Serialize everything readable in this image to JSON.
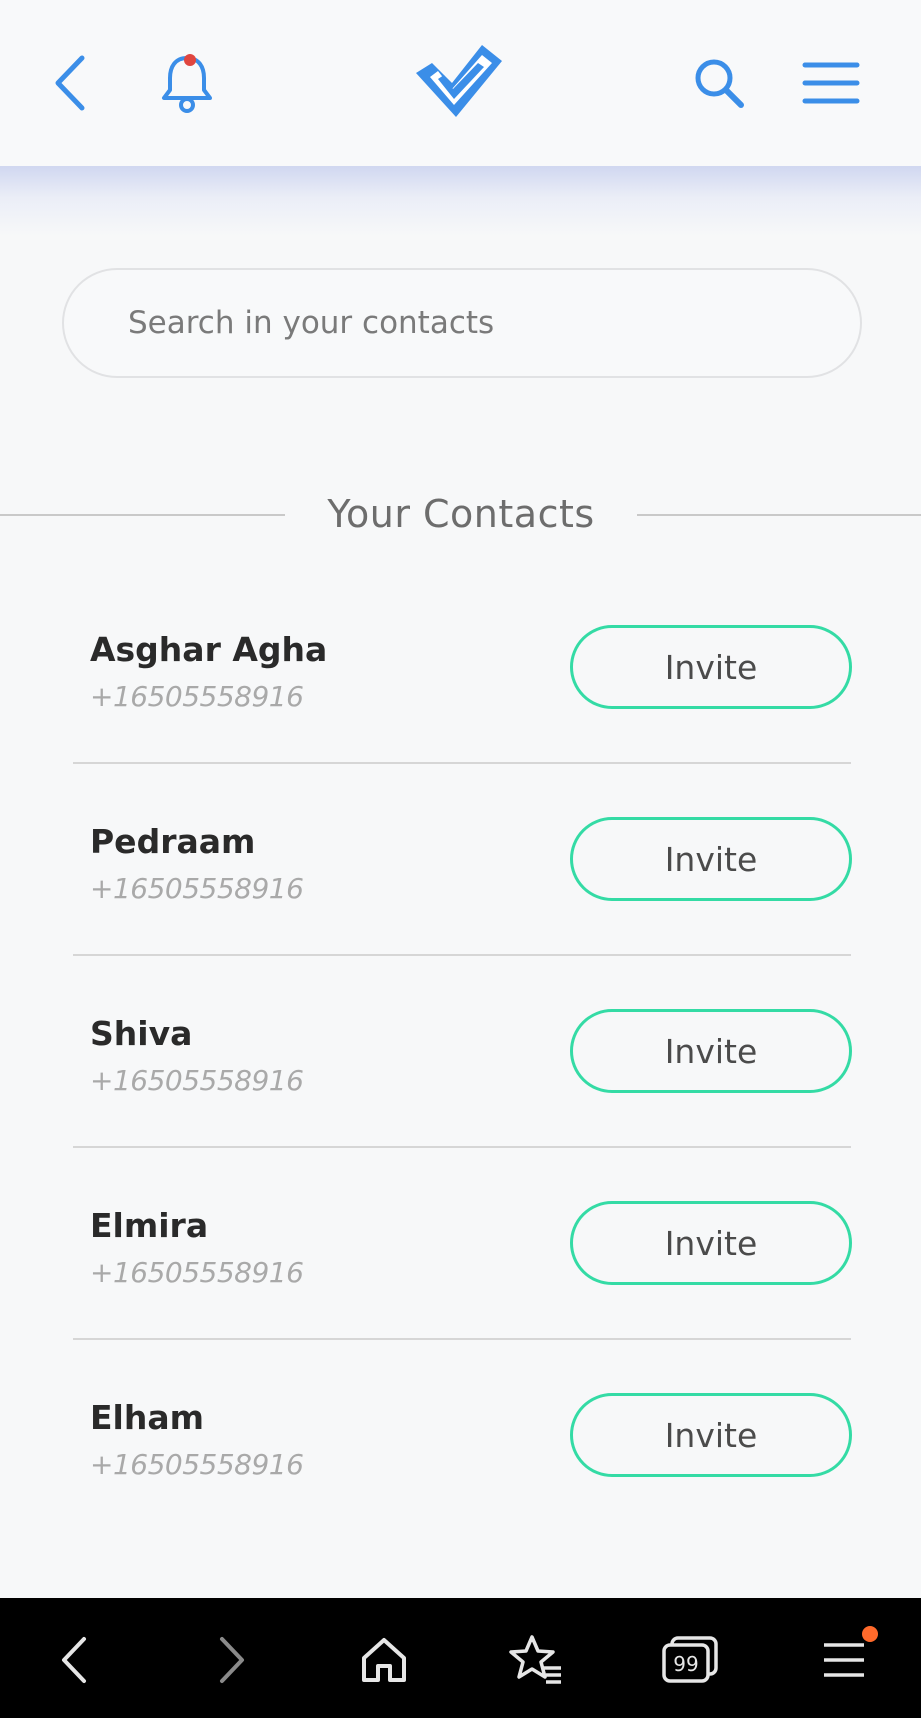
{
  "colors": {
    "accent_blue": "#3b8ee8",
    "invite_border": "#34dba5",
    "notification_dot": "#e0463f",
    "nav_badge": "#ff6a2b"
  },
  "header": {
    "icons": [
      "chevron-left-icon",
      "bell-icon",
      "double-check-logo",
      "search-icon",
      "hamburger-menu-icon"
    ]
  },
  "search": {
    "placeholder": "Search in your contacts",
    "value": ""
  },
  "section_title": "Your Contacts",
  "contacts": [
    {
      "name": "Asghar Agha",
      "phone": "+16505558916",
      "action": "Invite"
    },
    {
      "name": "Pedraam",
      "phone": "+16505558916",
      "action": "Invite"
    },
    {
      "name": "Shiva",
      "phone": "+16505558916",
      "action": "Invite"
    },
    {
      "name": "Elmira",
      "phone": "+16505558916",
      "action": "Invite"
    },
    {
      "name": "Elham",
      "phone": "+16505558916",
      "action": "Invite"
    }
  ],
  "bottom_nav": {
    "items": [
      "back-arrow-icon",
      "forward-arrow-icon",
      "home-icon",
      "bookmarks-icon",
      "tabs-icon",
      "menu-icon"
    ],
    "tabs_count": "99"
  }
}
